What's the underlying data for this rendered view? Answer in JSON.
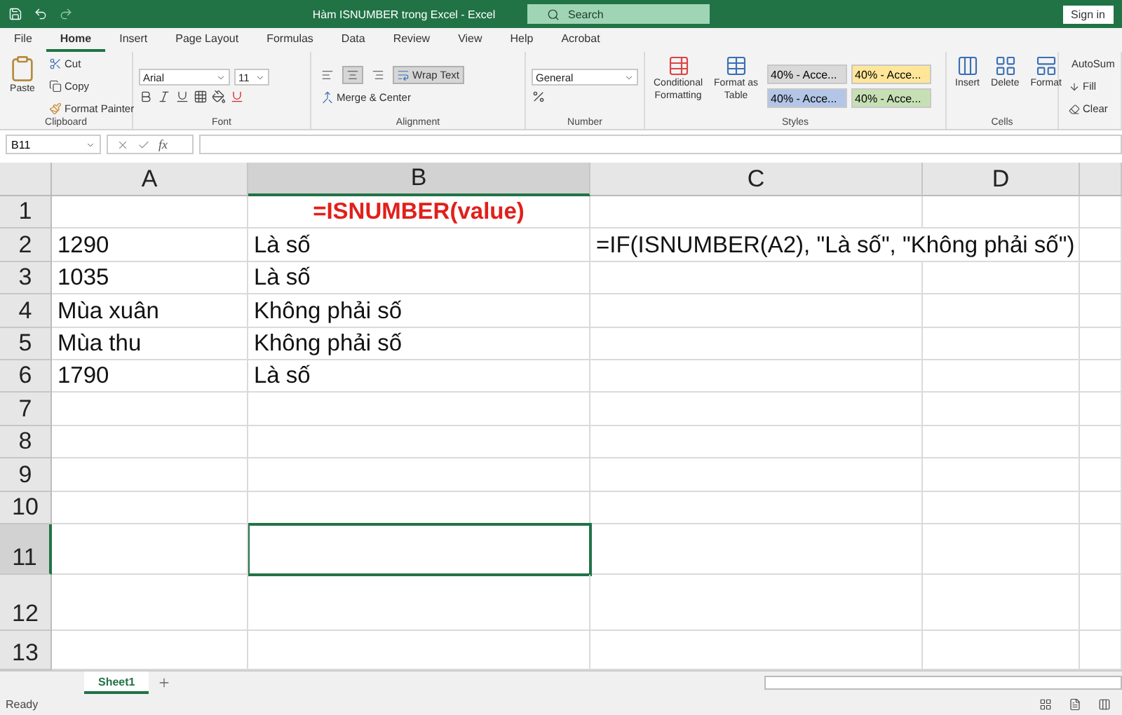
{
  "title_bar": {
    "title": "Hàm ISNUMBER trong Excel  -  Excel",
    "search_placeholder": "Search",
    "sign_in": "Sign in"
  },
  "menu_tabs": [
    {
      "label": "File",
      "selected": false
    },
    {
      "label": "Home",
      "selected": true
    },
    {
      "label": "Insert",
      "selected": false
    },
    {
      "label": "Page Layout",
      "selected": false
    },
    {
      "label": "Formulas",
      "selected": false
    },
    {
      "label": "Data",
      "selected": false
    },
    {
      "label": "Review",
      "selected": false
    },
    {
      "label": "View",
      "selected": false
    },
    {
      "label": "Help",
      "selected": false
    },
    {
      "label": "Acrobat",
      "selected": false
    }
  ],
  "ribbon": {
    "clipboard": {
      "label": "Clipboard",
      "paste": "Paste",
      "cut": "Cut",
      "copy": "Copy",
      "format_painter": "Format Painter"
    },
    "font": {
      "label": "Font",
      "font_name": "Arial",
      "font_size": "11"
    },
    "alignment": {
      "label": "Alignment",
      "horizontal_align": [
        {
          "selected": false
        },
        {
          "selected": true
        },
        {
          "selected": false
        }
      ],
      "wrap_text": {
        "label": "Wrap Text",
        "selected": true
      },
      "merge_center": "Merge & Center"
    },
    "number": {
      "label": "Number",
      "format": "General"
    },
    "styles": {
      "label": "Styles",
      "conditional_formatting": [
        "Conditional",
        "Formatting"
      ],
      "format_as_table": [
        "Format as",
        "Table"
      ],
      "cell_styles": [
        {
          "label": "40% - Acce...",
          "color": "#d9d9d9"
        },
        {
          "label": "40% - Acce...",
          "color": "#ffe699"
        },
        {
          "label": "40% - Acce...",
          "color": "#b4c6e7"
        },
        {
          "label": "40% - Acce...",
          "color": "#c6e0b4"
        }
      ]
    },
    "cells": {
      "label": "Cells",
      "buttons": [
        "Insert",
        "Delete",
        "Format"
      ]
    },
    "editing": [
      "AutoSum",
      "Fill",
      "Clear"
    ]
  },
  "formula_bar": {
    "name_box": "B11",
    "fx": "fx"
  },
  "sheet": {
    "columns": [
      {
        "label": "A",
        "selected": false
      },
      {
        "label": "B",
        "selected": true
      },
      {
        "label": "C",
        "selected": false
      },
      {
        "label": "D",
        "selected": false
      }
    ],
    "rows": [
      {
        "number": "1",
        "selected": false,
        "cells": [
          {
            "kind": "blank"
          },
          {
            "kind": "title",
            "text": "=ISNUMBER(value)"
          }
        ]
      },
      {
        "number": "2",
        "selected": false,
        "cells": [
          {
            "kind": "text",
            "text": "1290"
          },
          {
            "kind": "text",
            "text": "Là số"
          },
          {
            "kind": "text",
            "text": "=IF(ISNUMBER(A2), \"Là số\", \"Không phải số\")"
          }
        ]
      },
      {
        "number": "3",
        "selected": false,
        "cells": [
          {
            "kind": "text",
            "text": "1035"
          },
          {
            "kind": "text",
            "text": "Là số"
          }
        ]
      },
      {
        "number": "4",
        "selected": false,
        "cells": [
          {
            "kind": "text",
            "text": "Mùa xuân"
          },
          {
            "kind": "text",
            "text": "Không phải số"
          }
        ]
      },
      {
        "number": "5",
        "selected": false,
        "cells": [
          {
            "kind": "text",
            "text": "Mùa thu"
          },
          {
            "kind": "text",
            "text": "Không phải số"
          }
        ]
      },
      {
        "number": "6",
        "selected": false,
        "cells": [
          {
            "kind": "text",
            "text": "1790"
          },
          {
            "kind": "text",
            "text": "Là số"
          }
        ]
      },
      {
        "number": "7",
        "selected": false,
        "cells": []
      },
      {
        "number": "8",
        "selected": false,
        "cells": []
      },
      {
        "number": "9",
        "selected": false,
        "cells": []
      },
      {
        "number": "10",
        "selected": false,
        "cells": []
      },
      {
        "number": "11",
        "selected": true,
        "cells": []
      },
      {
        "number": "12",
        "selected": false,
        "cells": []
      },
      {
        "number": "13",
        "selected": false,
        "cells": []
      }
    ]
  },
  "sheet_tabs": [
    {
      "label": "Sheet1",
      "selected": true
    }
  ],
  "status": "Ready"
}
